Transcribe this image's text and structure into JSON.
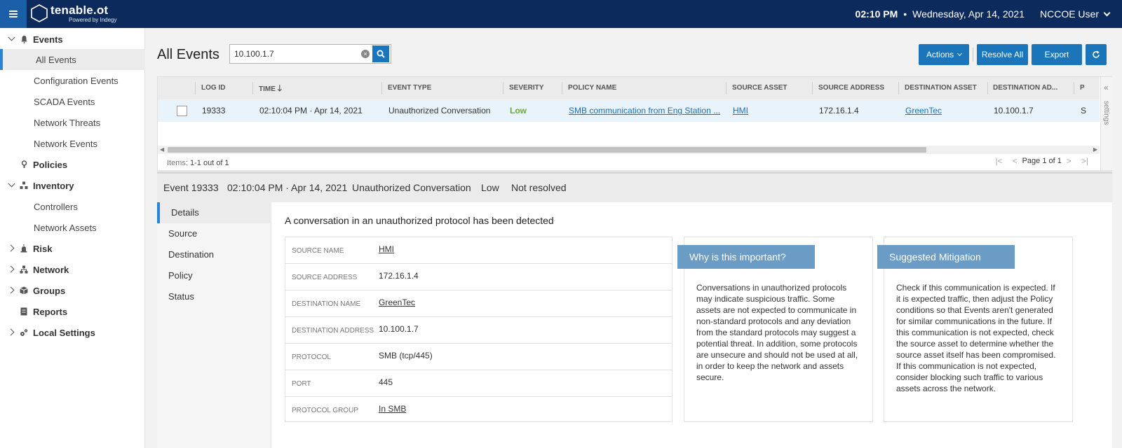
{
  "topbar": {
    "logo_main": "tenable.ot",
    "logo_sub": "Powered by Indegy",
    "time": "02:10 PM",
    "separator": "•",
    "date": "Wednesday, Apr 14, 2021",
    "user": "NCCOE User"
  },
  "sidebar": {
    "events": "Events",
    "all_events": "All Events",
    "configuration_events": "Configuration Events",
    "scada_events": "SCADA Events",
    "network_threats": "Network Threats",
    "network_events": "Network Events",
    "policies": "Policies",
    "inventory": "Inventory",
    "controllers": "Controllers",
    "network_assets": "Network Assets",
    "risk": "Risk",
    "network": "Network",
    "groups": "Groups",
    "reports": "Reports",
    "local_settings": "Local Settings"
  },
  "header": {
    "title": "All Events",
    "search_value": "10.100.1.7",
    "actions": "Actions",
    "resolve_all": "Resolve All",
    "export": "Export"
  },
  "table": {
    "columns": [
      "LOG ID",
      "TIME",
      "EVENT TYPE",
      "SEVERITY",
      "POLICY NAME",
      "SOURCE ASSET",
      "SOURCE ADDRESS",
      "DESTINATION ASSET",
      "DESTINATION AD...",
      "P"
    ],
    "row": {
      "log_id": "19333",
      "time": "02:10:04 PM · Apr 14, 2021",
      "event_type": "Unauthorized Conversation",
      "severity": "Low",
      "policy_name": "SMB communication from Eng Station ...",
      "source_asset": "HMI",
      "source_address": "172.16.1.4",
      "destination_asset": "GreenTec",
      "destination_address": "10.100.1.7",
      "p": "S"
    },
    "settings_label": "settings",
    "items_label": "Items:",
    "items_value": "1-1 out of 1",
    "page_label": "Page 1 of 1"
  },
  "event": {
    "id": "Event 19333",
    "time": "02:10:04 PM · Apr 14, 2021",
    "type": "Unauthorized Conversation",
    "severity": "Low",
    "status": "Not resolved"
  },
  "tabs": [
    "Details",
    "Source",
    "Destination",
    "Policy",
    "Status"
  ],
  "details": {
    "heading": "A conversation in an unauthorized protocol has been detected",
    "rows": [
      {
        "key": "SOURCE NAME",
        "value": "HMI"
      },
      {
        "key": "SOURCE ADDRESS",
        "value": "172.16.1.4"
      },
      {
        "key": "DESTINATION NAME",
        "value": "GreenTec"
      },
      {
        "key": "DESTINATION ADDRESS",
        "value": "10.100.1.7"
      },
      {
        "key": "PROTOCOL",
        "value": "SMB (tcp/445)"
      },
      {
        "key": "PORT",
        "value": "445"
      },
      {
        "key": "PROTOCOL GROUP",
        "value": "In SMB"
      }
    ],
    "why_title": "Why is this important?",
    "why_body": "Conversations in unauthorized protocols may indicate suspicious traffic. Some assets are not expected to communicate in non-standard protocols and any deviation from the standard protocols may suggest a potential threat. In addition, some protocols are unsecure and should not be used at all, in order to keep the network and assets secure.",
    "mitigation_title": "Suggested Mitigation",
    "mitigation_body": "Check if this communication is expected. If it is expected traffic, then adjust the Policy conditions so that Events aren't generated for similar communications in the future. If this communication is not expected, check the source asset to determine whether the source asset itself has been compromised. If this communication is not expected, consider blocking such traffic to various assets across the network."
  }
}
